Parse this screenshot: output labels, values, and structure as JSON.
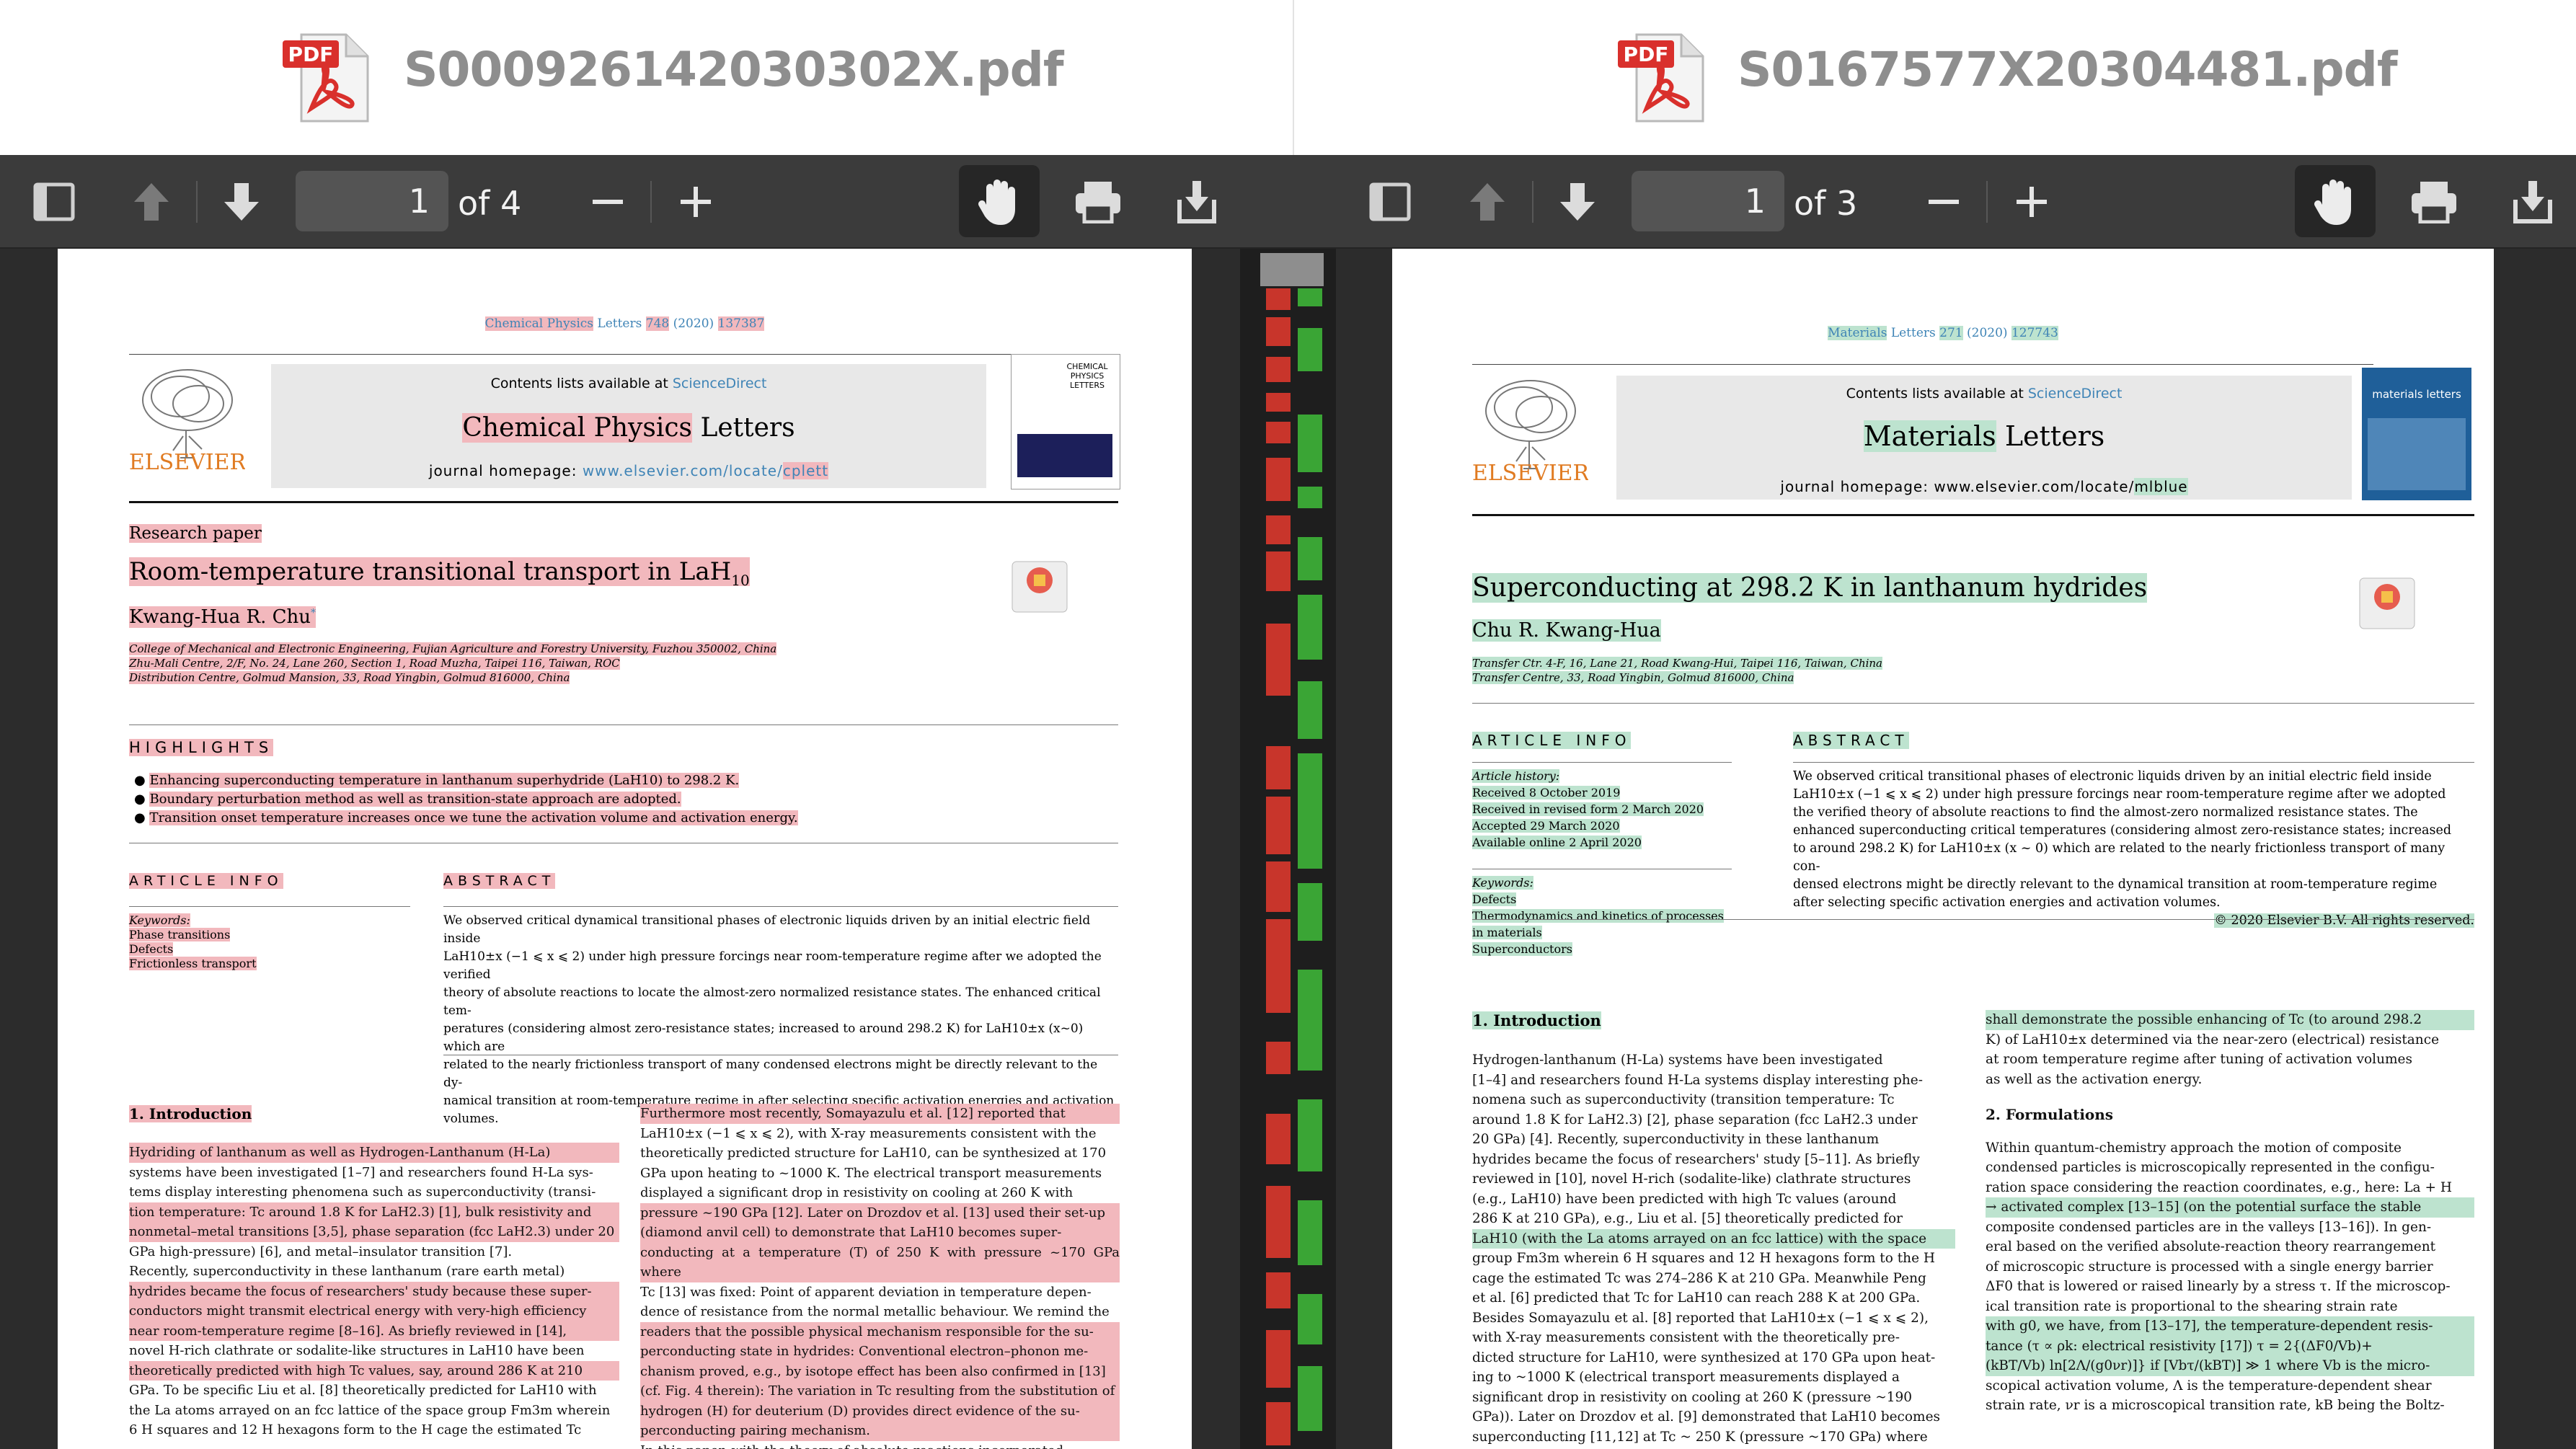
{
  "left_window": {
    "file_name": "S000926142030302X.pdf",
    "toolbar": {
      "page_number": "1",
      "of_pages": "of 4"
    },
    "paper": {
      "citation": {
        "journal": "Chemical Physics",
        "letters": "Letters",
        "volume": "748",
        "year": "(2020)",
        "article": "137387"
      },
      "contents": "Contents lists available at",
      "sciencedirect": "ScienceDirect",
      "journal_title_a": "Chemical Physics",
      "journal_title_b": "Letters",
      "homepage_prefix": "journal homepage:",
      "homepage_url": "www.elsevier.com/locate/",
      "homepage_code": "cplett",
      "publisher": "ELSEVIER",
      "cover_text": "CHEMICAL PHYSICS LETTERS",
      "type": "Research paper",
      "title": "Room-temperature transitional transport in LaH",
      "title_sub": "10",
      "author": "Kwang-Hua R. Chu",
      "author_mark": "*",
      "affiliation_1": "College of Mechanical and Electronic Engineering, Fujian Agriculture and Forestry University, Fuzhou 350002, China",
      "affiliation_2": "Zhu-Mali Centre, 2/F, No. 24, Lane 260, Section 1, Road Muzha, Taipei 116, Taiwan, ROC",
      "affiliation_3": "Distribution Centre, Golmud Mansion, 33, Road Yingbin, Golmud 816000, China",
      "highlights_heading": "HIGHLIGHTS",
      "highlights": [
        "Enhancing superconducting temperature in lanthanum superhydride (LaH10) to 298.2 K.",
        "Boundary perturbation method as well as transition-state approach are adopted.",
        "Transition onset temperature increases once we tune the activation volume and activation energy."
      ],
      "article_info_heading": "ARTICLE INFO",
      "abstract_heading": "ABSTRACT",
      "keywords_label": "Keywords:",
      "keywords": [
        "Phase transitions",
        "Defects",
        "Frictionless transport"
      ],
      "abstract_lines": [
        "We observed critical dynamical transitional phases of electronic liquids driven by an initial electric field inside",
        "LaH10±x (−1 ⩽ x ⩽ 2) under high pressure forcings near room-temperature regime after we adopted the verified",
        "theory of absolute reactions to locate the almost-zero normalized resistance states. The enhanced critical tem-",
        "peratures (considering almost zero-resistance states; increased to around 298.2 K) for LaH10±x (x~0) which are",
        "related to the nearly frictionless transport of many condensed electrons might be directly relevant to the dy-",
        "namical transition at room-temperature regime in after selecting specific activation energies and activation",
        "volumes."
      ],
      "intro_heading": "1.  Introduction",
      "col1_lines": [
        "Hydriding of lanthanum as well as Hydrogen-Lanthanum (H-La)",
        "systems have been investigated [1–7] and researchers found H-La sys-",
        "tems display interesting phenomena such as superconductivity (transi-",
        "tion temperature: Tc around 1.8 K for LaH2.3) [1], bulk resistivity and",
        "nonmetal–metal transitions [3,5], phase separation (fcc LaH2.3) under 20",
        "GPa high-pressure) [6], and metal–insulator transition [7].",
        "Recently, superconductivity in these lanthanum (rare earth metal)",
        "hydrides became the focus of researchers' study because these super-",
        "conductors might transmit electrical energy with very-high efficiency",
        "near room-temperature regime [8–16]. As briefly reviewed in [14],",
        "novel H-rich clathrate or sodalite-like structures in LaH10 have been",
        "theoretically predicted with high Tc values, say, around 286 K at 210",
        "GPa. To be specific Liu et al. [8] theoretically predicted for LaH10 with",
        "the La atoms arrayed on an fcc lattice of the space group Fm3m wherein",
        "6 H squares and 12 H hexagons form to the H cage the estimated Tc"
      ],
      "col2_lines": [
        "Furthermore most recently, Somayazulu et al. [12] reported that",
        "LaH10±x (−1 ⩽ x ⩽ 2), with X-ray measurements consistent with the",
        "theoretically predicted structure for LaH10, can be synthesized at 170",
        "GPa upon heating to ~1000 K. The electrical transport measurements",
        "displayed a significant drop in resistivity on cooling at 260 K with",
        "pressure ~190 GPa [12]. Later on Drozdov et al. [13] used their set-up",
        "(diamond anvil cell) to demonstrate that LaH10 becomes super-",
        "conducting at a temperature (T) of 250 K with pressure ~170 GPa where",
        "Tc [13] was fixed: Point of apparent deviation in temperature depen-",
        "dence of resistance from the normal metallic behaviour. We remind the",
        "readers that the possible physical mechanism responsible for the su-",
        "perconducting state in hydrides: Conventional electron–phonon me-",
        "chanism proved, e.g., by isotope effect has been also confirmed in [13]",
        "(cf. Fig. 4 therein): The variation in Tc resulting from the substitution of",
        "hydrogen (H) for deuterium (D) provides direct evidence of the su-",
        "perconducting pairing mechanism.",
        "In this paper, with the theory of absolute reactions incorporated"
      ]
    }
  },
  "right_window": {
    "file_name": "S0167577X20304481.pdf",
    "toolbar": {
      "page_number": "1",
      "of_pages": "of 3"
    },
    "paper": {
      "citation": {
        "journal": "Materials",
        "letters": "Letters",
        "volume": "271",
        "year": "(2020)",
        "article": "127743"
      },
      "contents": "Contents lists available at",
      "sciencedirect": "ScienceDirect",
      "journal_title_a": "Materials",
      "journal_title_b": "Letters",
      "homepage_prefix": "journal homepage: www.elsevier.com/locate/",
      "homepage_code": "mlblue",
      "publisher": "ELSEVIER",
      "cover_text": "materials letters",
      "title": "Superconducting at 298.2 K in lanthanum hydrides",
      "author": "Chu R. Kwang-Hua",
      "affiliation_1": "Transfer Ctr. 4-F, 16, Lane 21, Road Kwang-Hui, Taipei 116, Taiwan, China",
      "affiliation_2": "Transfer Centre, 33, Road Yingbin, Golmud 816000, China",
      "article_info_heading": "ARTICLE INFO",
      "abstract_heading": "ABSTRACT",
      "history_label": "Article history:",
      "history": [
        "Received 8 October 2019",
        "Received in revised form 2 March 2020",
        "Accepted 29 March 2020",
        "Available online 2 April 2020"
      ],
      "keywords_label": "Keywords:",
      "keywords": [
        "Defects",
        "Thermodynamics and kinetics of processes",
        "in materials",
        "Superconductors"
      ],
      "abstract_lines": [
        "We observed critical transitional phases of electronic liquids driven by an initial electric field inside",
        "LaH10±x (−1 ⩽ x ⩽ 2) under high pressure forcings near room-temperature regime after we adopted",
        "the verified theory of absolute reactions to find the almost-zero normalized resistance states. The",
        "enhanced superconducting critical temperatures (considering almost zero-resistance states; increased",
        "to around 298.2 K) for LaH10±x (x ~ 0) which are related to the nearly frictionless transport of many con-",
        "densed electrons might be directly relevant to the dynamical transition at room-temperature regime",
        "after selecting specific activation energies and activation volumes."
      ],
      "copyright": "© 2020 Elsevier B.V. All rights reserved.",
      "intro_heading": "1. Introduction",
      "col1_lines": [
        "Hydrogen-lanthanum (H-La) systems have been investigated",
        "[1–4] and researchers found H-La systems display interesting phe-",
        "nomena such as superconductivity (transition temperature: Tc",
        "around 1.8 K for LaH2.3) [2], phase separation (fcc LaH2.3 under",
        "20 GPa) [4]. Recently, superconductivity in these lanthanum",
        "hydrides became the focus of researchers' study [5–11]. As briefly",
        "reviewed in [10], novel H-rich (sodalite-like) clathrate structures",
        "(e.g., LaH10) have been predicted with high Tc values (around",
        "286 K at 210 GPa), e.g., Liu et al. [5] theoretically predicted for",
        "LaH10 (with the La atoms arrayed on an fcc lattice) with the space",
        "group Fm3m wherein 6 H squares and 12 H hexagons form to the H",
        "cage the estimated Tc was 274–286 K at 210 GPa. Meanwhile Peng",
        "et al. [6] predicted that Tc for LaH10 can reach 288 K at 200 GPa.",
        "Besides Somayazulu et al. [8] reported that LaH10±x (−1 ⩽ x ⩽ 2),",
        "with X-ray measurements consistent with the theoretically pre-",
        "dicted structure for LaH10, were synthesized at 170 GPa upon heat-",
        "ing to ~1000 K (electrical transport measurements displayed a",
        "significant drop in resistivity on cooling at 260 K (pressure ~190",
        "GPa)). Later on Drozdov et al. [9] demonstrated that LaH10 becomes",
        "superconducting [11,12] at Tc ~ 250 K (pressure ~170 GPa) where"
      ],
      "col2_lines": [
        "shall demonstrate the possible enhancing of Tc (to around 298.2",
        "K) of LaH10±x determined via the near-zero (electrical) resistance",
        "at room temperature regime after tuning of activation volumes",
        "as well as the activation energy."
      ],
      "formulations_heading": "2. Formulations",
      "col2b_lines": [
        "Within quantum-chemistry approach the motion of composite",
        "condensed particles is microscopically represented in the configu-",
        "ration space considering the reaction coordinates, e.g., here: La + H",
        "→ activated complex [13–15] (on the potential surface the stable",
        "composite condensed particles are in the valleys [13–16]). In gen-",
        "eral based on the verified absolute-reaction theory rearrangement",
        "of microscopic structure is processed with a single energy barrier",
        "ΔF0 that is lowered or raised linearly by a stress τ. If the microscop-",
        "ical transition rate is proportional to the shearing strain rate",
        "with g0, we have, from [13–17], the temperature-dependent resis-",
        "tance (τ ∝ ρk: electrical resistivity [17]) τ = 2{(ΔF0/Vb)+",
        "(kBT/Vb) ln[2Λ/(g0νr)]} if [Vbτ/(kBT)] ≫ 1 where Vb is the micro-",
        "scopical activation volume, Λ is the temperature-dependent shear",
        "strain rate, νr is a microscopical transition rate, kB being the Boltz-"
      ]
    }
  },
  "colors": {
    "highlight_red": "#f2b8bd",
    "highlight_green": "#bde3cf",
    "diff_red": "#c8352b",
    "diff_green": "#3aa535",
    "link": "#3f84b6",
    "toolbar": "#3b3b3b"
  },
  "icons": [
    "pdf-file-icon",
    "sidebar-toggle-icon",
    "page-up-icon",
    "page-down-icon",
    "zoom-out-icon",
    "zoom-in-icon",
    "hand-tool-icon",
    "print-icon",
    "download-icon"
  ]
}
